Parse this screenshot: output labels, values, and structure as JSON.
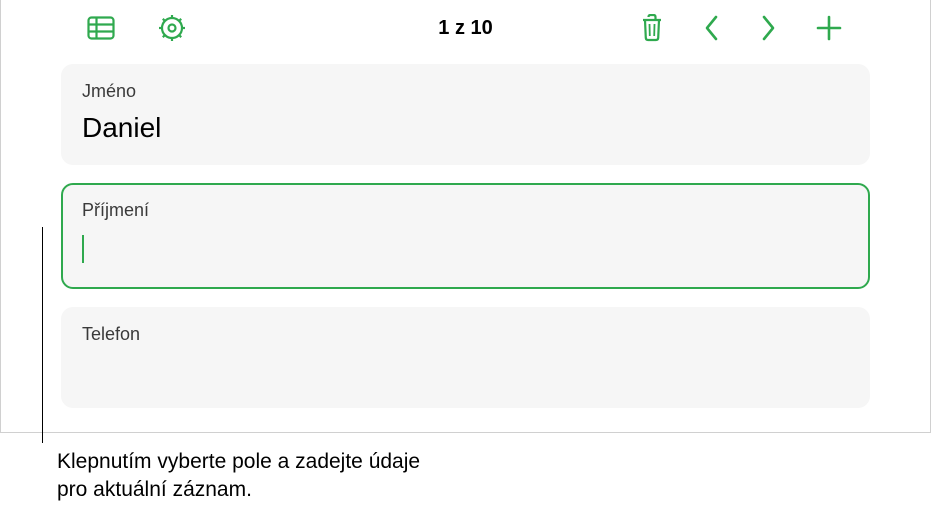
{
  "toolbar": {
    "counter": "1 z 10"
  },
  "fields": [
    {
      "label": "Jméno",
      "value": "Daniel"
    },
    {
      "label": "Příjmení",
      "value": ""
    },
    {
      "label": "Telefon",
      "value": ""
    }
  ],
  "callout": "Klepnutím vyberte pole a zadejte údaje pro aktuální záznam.",
  "colors": {
    "accent": "#2fa94e",
    "card_bg": "#f6f6f6"
  }
}
